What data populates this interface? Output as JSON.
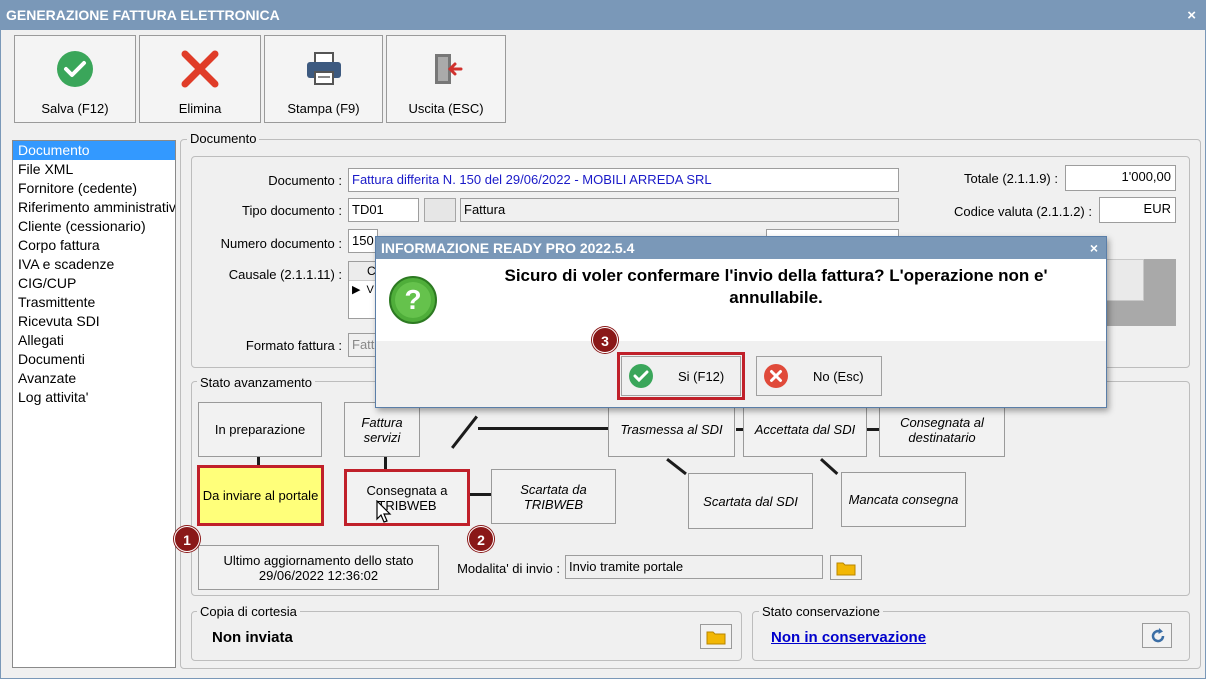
{
  "window": {
    "title": "GENERAZIONE FATTURA ELETTRONICA",
    "close": "×"
  },
  "toolbar": {
    "save": "Salva (F12)",
    "save_icon": "check-circle-icon",
    "delete": "Elimina",
    "delete_icon": "red-x-icon",
    "print": "Stampa (F9)",
    "print_icon": "printer-icon",
    "exit": "Uscita (ESC)",
    "exit_icon": "door-exit-icon"
  },
  "sidebar": {
    "items": [
      "Documento",
      "File XML",
      "Fornitore (cedente)",
      "Riferimento amministrativo",
      "Cliente (cessionario)",
      "Corpo fattura",
      "IVA e scadenze",
      "CIG/CUP",
      "Trasmittente",
      "Ricevuta SDI",
      "Allegati",
      "Documenti",
      "Avanzate",
      "Log attivita'"
    ],
    "selected_index": 0
  },
  "documento": {
    "group_title": "Documento",
    "documento_label": "Documento :",
    "documento_value": "Fattura differita N. 150 del 29/06/2022 - MOBILI ARREDA SRL",
    "tipo_label": "Tipo documento :",
    "tipo_code": "TD01",
    "tipo_desc": "Fattura",
    "numero_label": "Numero documento :",
    "numero_value": "150",
    "causale_label": "Causale (2.1.1.11) :",
    "causale_col_head": "C",
    "causale_row_marker": "▶",
    "causale_row_text": "V",
    "formato_label": "Formato fattura :",
    "formato_value": "Fatt",
    "totale_label": "Totale (2.1.1.9) :",
    "totale_value": "1'000,00",
    "valuta_label": "Codice valuta (2.1.1.2) :",
    "valuta_value": "EUR"
  },
  "stato": {
    "group_title": "Stato avanzamento",
    "boxes": {
      "in_preparazione": "In preparazione",
      "fattura_servizi": "Fattura servizi",
      "trasmessa_sdi": "Trasmessa al SDI",
      "accettata_sdi": "Accettata dal SDI",
      "consegnata_dest": "Consegnata al destinatario",
      "da_inviare": "Da inviare al portale",
      "consegnata_tribweb": "Consegnata a TRIBWEB",
      "scartata_tribweb": "Scartata da TRIBWEB",
      "scartata_sdi": "Scartata dal SDI",
      "mancata_consegna": "Mancata consegna"
    },
    "ultimo_agg": "Ultimo aggiornamento dello stato",
    "ultimo_agg_date": "29/06/2022 12:36:02",
    "modalita_label": "Modalita' di invio :",
    "modalita_value": "Invio tramite portale",
    "folder_icon": "folder-icon"
  },
  "copia": {
    "group_title": "Copia di cortesia",
    "value": "Non inviata",
    "folder_icon": "folder-icon"
  },
  "conservazione": {
    "group_title": "Stato conservazione",
    "link": "Non in conservazione",
    "refresh_icon": "refresh-icon"
  },
  "annotations": {
    "badge1": "1",
    "badge2": "2",
    "badge3": "3"
  },
  "dialog": {
    "title": "INFORMAZIONE READY PRO 2022.5.4",
    "close": "×",
    "message": "Sicuro di voler confermare l'invio della fattura? L'operazione non e' annullabile.",
    "icon": "question-icon",
    "yes": "Si (F12)",
    "no": "No (Esc)"
  },
  "colors": {
    "titlebar": "#7a98b8",
    "selection": "#3399ff",
    "highlight": "#c0202a",
    "yellow": "#ffff7a",
    "link": "#0000cc"
  }
}
